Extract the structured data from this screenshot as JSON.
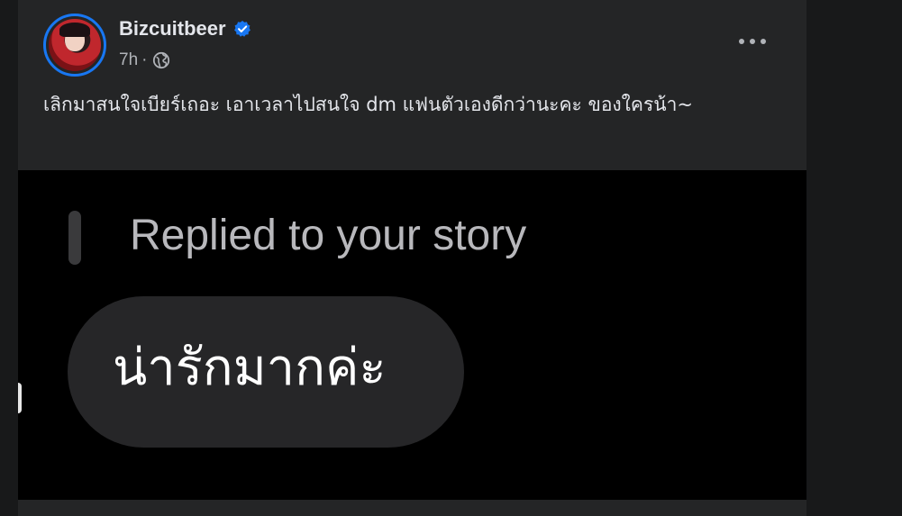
{
  "post": {
    "author": "Bizcuitbeer",
    "verified": true,
    "time": "7h",
    "separator": "·",
    "audience_icon": "globe-icon",
    "more_icon": "more-options-icon",
    "text": "เลิกมาสนใจเบียร์เถอะ เอาเวลาไปสนใจ dm แฟนตัวเองดีกว่านะคะ ของใครน้า~"
  },
  "media": {
    "reply_label": "Replied to your story",
    "message": "น่ารักมากค่ะ"
  },
  "colors": {
    "page_background": "#18191a",
    "card_background": "#242526",
    "primary_text": "#e4e6eb",
    "secondary_text": "#b0b3b8",
    "verified_blue": "#1877f2",
    "media_background": "#000000",
    "bubble_background": "#262628"
  }
}
